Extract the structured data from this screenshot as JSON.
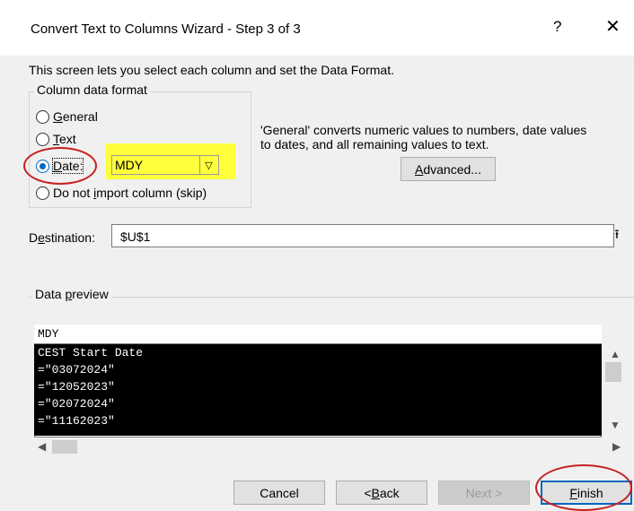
{
  "window": {
    "title": "Convert Text to Columns Wizard - Step 3 of 3",
    "help_label": "?",
    "close_label": "✕"
  },
  "intro_text": "This screen lets you select each column and set the Data Format.",
  "column_format": {
    "group_label": "Column data format",
    "options": [
      {
        "prefix": "",
        "key": "G",
        "rest": "eneral",
        "selected": false
      },
      {
        "prefix": "",
        "key": "T",
        "rest": "ext",
        "selected": false
      },
      {
        "prefix": "",
        "key": "D",
        "rest": "ate:",
        "selected": true
      },
      {
        "prefix": "Do not ",
        "key": "i",
        "rest": "mport column (skip)",
        "selected": false
      }
    ],
    "date_format_value": "MDY",
    "description_line1": "'General' converts numeric values to numbers, date values",
    "description_line2": "to dates, and all remaining values to text.",
    "advanced_prefix": "",
    "advanced_key": "A",
    "advanced_rest": "dvanced..."
  },
  "destination": {
    "label_prefix": "D",
    "label_key": "e",
    "label_rest": "stination:",
    "value": "$U$1",
    "collapse_icon": "⭱"
  },
  "preview": {
    "label_prefix": "Data ",
    "label_key": "p",
    "label_rest": "review",
    "column_header": "MDY",
    "rows": [
      "CEST Start Date",
      "=\"03072024\"",
      "=\"12052023\"",
      "=\"02072024\"",
      "=\"11162023\""
    ]
  },
  "buttons": {
    "cancel": "Cancel",
    "back_prefix": "< ",
    "back_key": "B",
    "back_rest": "ack",
    "next": "Next >",
    "finish_key": "F",
    "finish_rest": "inish"
  },
  "colors": {
    "highlight": "#ffff3b",
    "annotation_ring": "#c82020",
    "accent": "#0067c0"
  }
}
